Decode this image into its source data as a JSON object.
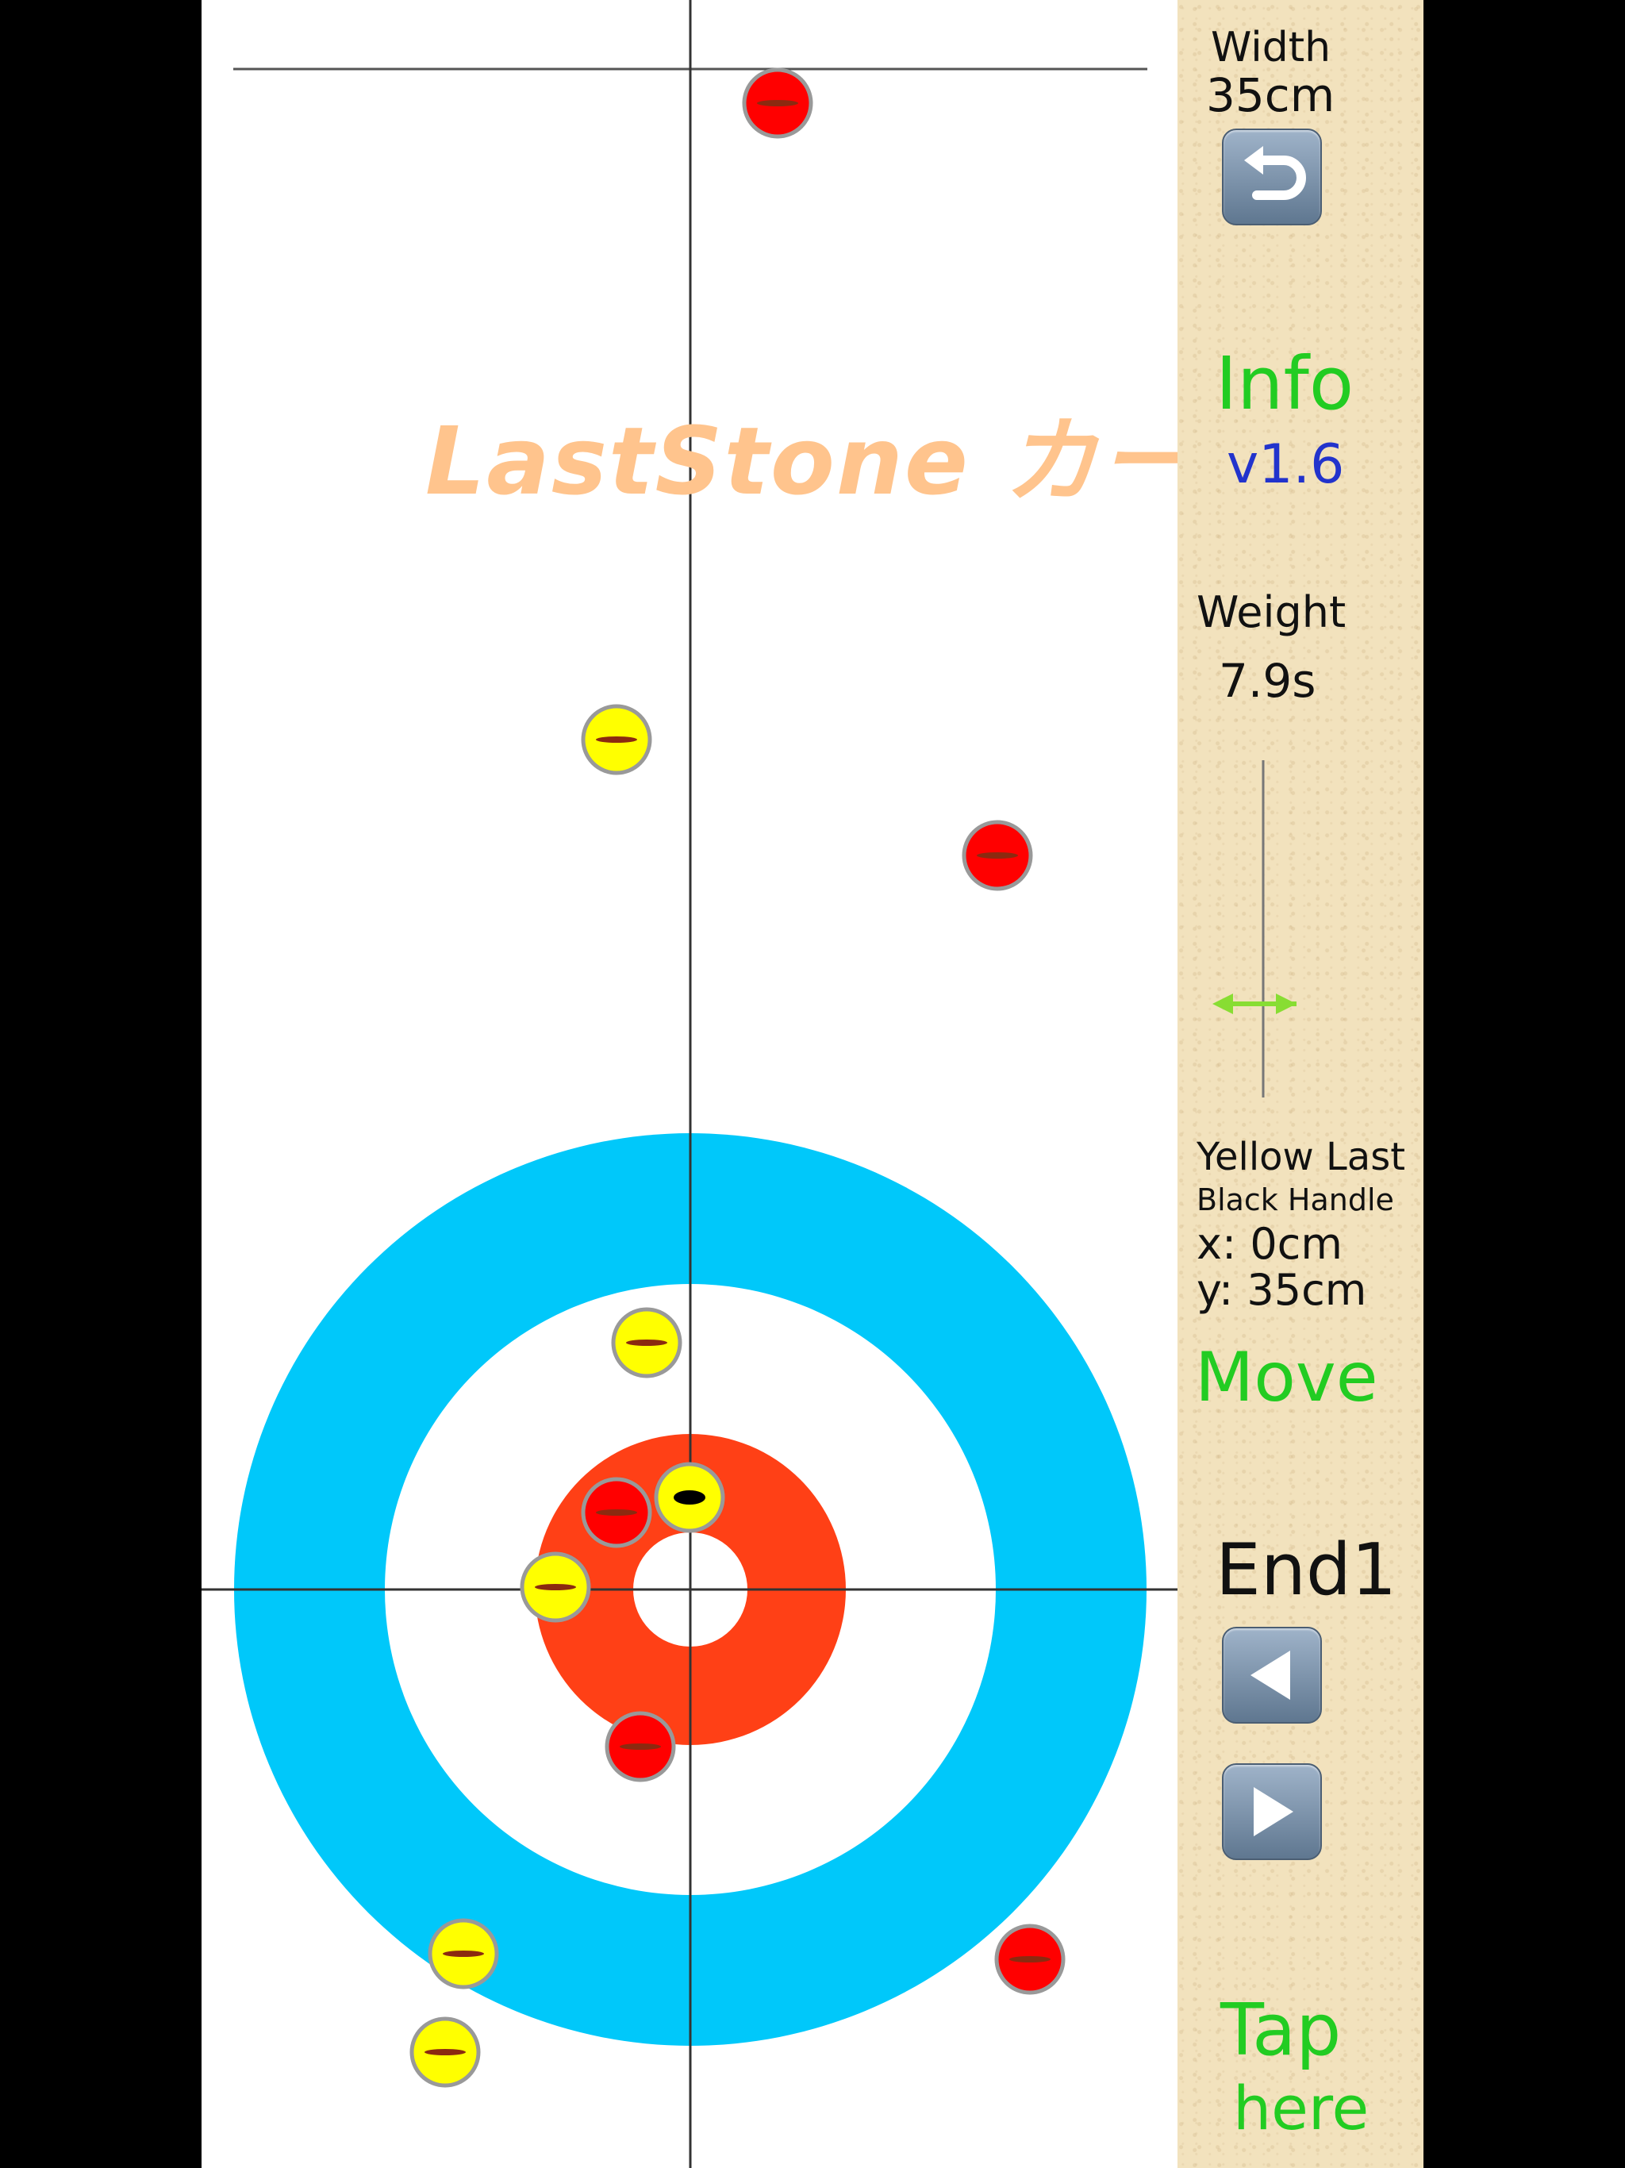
{
  "title": "LastStone カー娘銅",
  "sidebar": {
    "width_label": "Width",
    "width_value": "35cm",
    "info_label": "Info",
    "version": "v1.6",
    "weight_label": "Weight",
    "weight_value": "7.9s",
    "last_stone": "Yellow Last",
    "handle": "Black Handle",
    "x_readout": "x: 0cm",
    "y_readout": "y: 35cm",
    "move_label": "Move",
    "end_label": "End1",
    "tap_label": "Tap",
    "here_label": "here"
  },
  "icons": {
    "width_reset": "return-arrow-icon",
    "prev_end": "left-triangle-icon",
    "next_end": "right-triangle-icon",
    "weight_slider": "double-arrow-icon"
  },
  "colors": {
    "twelve_foot": "#00c8fa",
    "button": "#ff4016",
    "red_stone": "#ff0000",
    "yellow_stone": "#ffff00",
    "title": "#ffc48d",
    "info": "#22cc22",
    "version": "#2233cc",
    "sidebar_bg": "#f2e2bd"
  },
  "stones": [
    {
      "color": "red",
      "handle": "brown"
    },
    {
      "color": "yellow",
      "handle": "brown"
    },
    {
      "color": "red",
      "handle": "brown"
    },
    {
      "color": "yellow",
      "handle": "brown"
    },
    {
      "color": "red",
      "handle": "brown"
    },
    {
      "color": "yellow",
      "handle": "black"
    },
    {
      "color": "yellow",
      "handle": "brown"
    },
    {
      "color": "red",
      "handle": "brown"
    },
    {
      "color": "yellow",
      "handle": "brown"
    },
    {
      "color": "red",
      "handle": "brown"
    },
    {
      "color": "yellow",
      "handle": "brown"
    }
  ]
}
